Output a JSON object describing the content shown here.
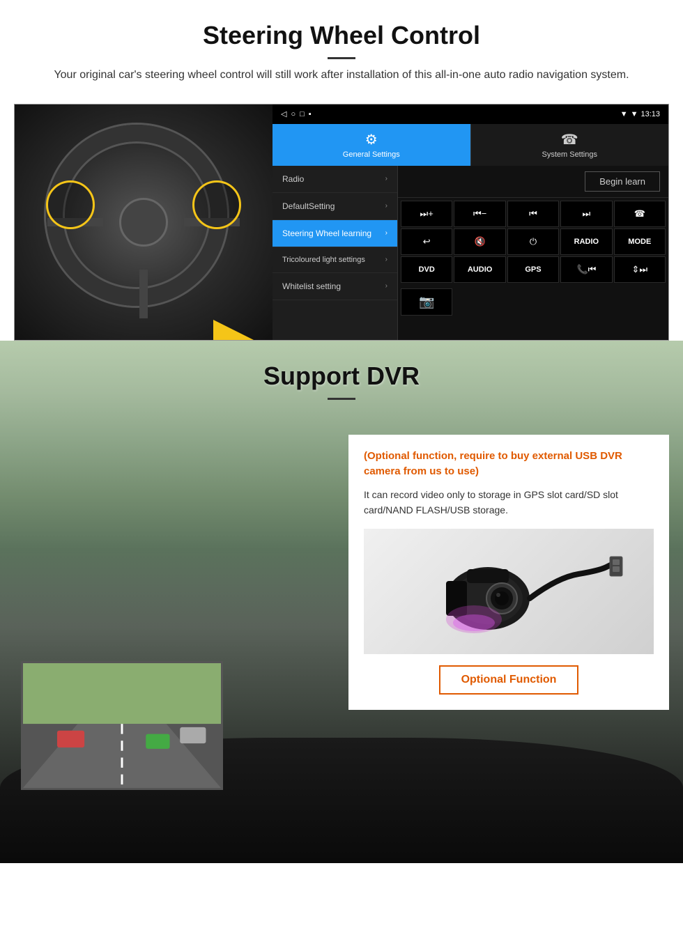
{
  "section1": {
    "title": "Steering Wheel Control",
    "description": "Your original car's steering wheel control will still work after installation of this all-in-one auto radio navigation system.",
    "statusbar": {
      "time": "13:13",
      "signal_icon": "▼",
      "wifi_icon": "▼",
      "battery_icon": "▐"
    },
    "navbar_icons": [
      "◁",
      "○",
      "□",
      "■"
    ],
    "tabs": [
      {
        "id": "general",
        "label": "General Settings",
        "icon": "⚙",
        "active": true
      },
      {
        "id": "system",
        "label": "System Settings",
        "icon": "☎",
        "active": false
      }
    ],
    "menu_items": [
      {
        "label": "Radio",
        "active": false
      },
      {
        "label": "DefaultSetting",
        "active": false
      },
      {
        "label": "Steering Wheel learning",
        "active": true
      },
      {
        "label": "Tricoloured light settings",
        "active": false
      },
      {
        "label": "Whitelist setting",
        "active": false
      }
    ],
    "begin_learn": "Begin learn",
    "controls": [
      "⏭+",
      "⏮−",
      "⏮⏮",
      "⏭⏭",
      "☎",
      "↩",
      "🔇",
      "⏻",
      "RADIO",
      "MODE",
      "DVD",
      "AUDIO",
      "GPS",
      "📞⏮",
      "↕⏭⏭"
    ]
  },
  "section2": {
    "title": "Support DVR",
    "optional_highlight": "(Optional function, require to buy external USB DVR camera from us to use)",
    "description": "It can record video only to storage in GPS slot card/SD slot card/NAND FLASH/USB storage.",
    "optional_function_btn": "Optional Function"
  }
}
